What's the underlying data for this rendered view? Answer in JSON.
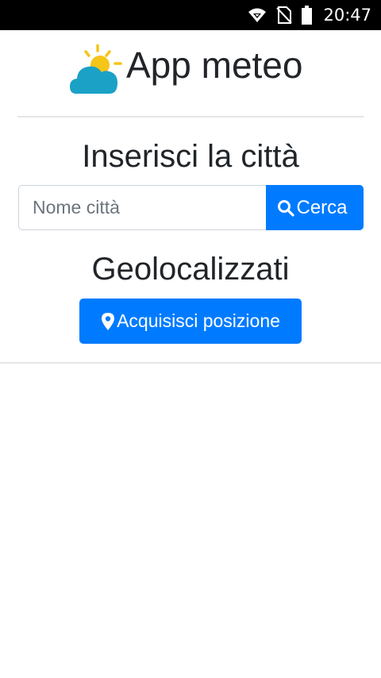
{
  "status_bar": {
    "time": "20:47",
    "icons": [
      "wifi-icon",
      "no-sim-icon",
      "battery-icon"
    ]
  },
  "header": {
    "title": "App meteo",
    "logo_icon": "sun-cloud-icon"
  },
  "city_search": {
    "heading": "Inserisci la città",
    "input_placeholder": "Nome città",
    "input_value": "",
    "button_label": "Cerca",
    "button_icon": "search-icon"
  },
  "geolocation": {
    "heading": "Geolocalizzati",
    "button_label": "Acquisisci posizione",
    "button_icon": "map-pin-icon"
  },
  "colors": {
    "primary": "#007bff",
    "text": "#212529",
    "cloud": "#1ba1c6",
    "sun": "#f5c518"
  }
}
